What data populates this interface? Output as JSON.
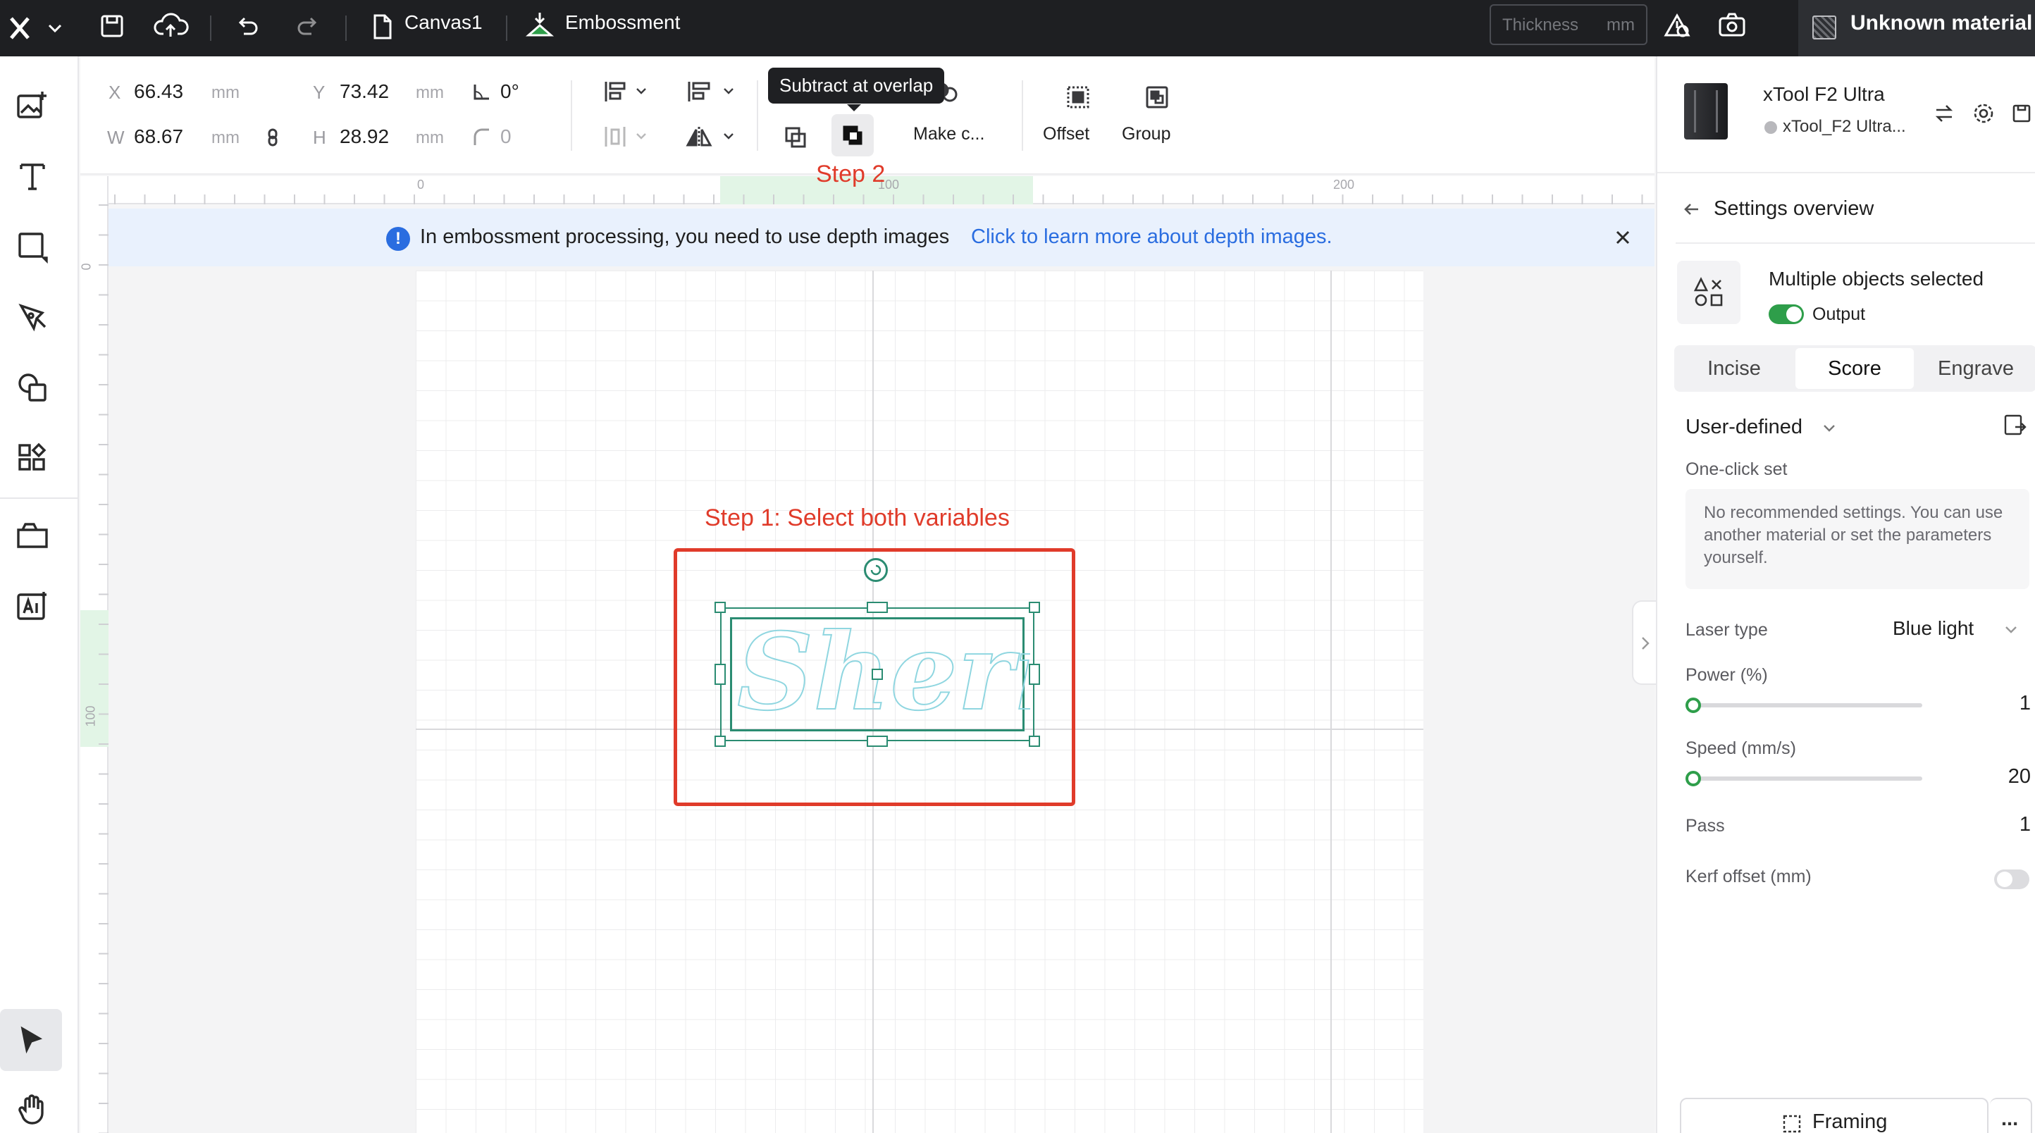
{
  "topbar": {
    "file_name": "Canvas1",
    "mode_name": "Embossment",
    "thickness_placeholder": "Thickness",
    "thickness_unit": "mm",
    "material_label": "Unknown material"
  },
  "props": {
    "x_label": "X",
    "x_value": "66.43",
    "x_unit": "mm",
    "y_label": "Y",
    "y_value": "73.42",
    "y_unit": "mm",
    "rotation_value": "0°",
    "w_label": "W",
    "w_value": "68.67",
    "w_unit": "mm",
    "h_label": "H",
    "h_value": "28.92",
    "h_unit": "mm",
    "corner_value": "0",
    "make_label": "Make c...",
    "offset_label": "Offset",
    "group_label": "Group",
    "tooltip": "Subtract at overlap"
  },
  "ruler": {
    "h_ticks": [
      "0",
      "100",
      "200"
    ],
    "v_ticks": [
      "0",
      "100"
    ]
  },
  "banner": {
    "text": "In embossment processing, you need to use depth images",
    "link": "Click to learn more about depth images."
  },
  "annotations": {
    "step1": "Step 1: Select both variables",
    "step2": "Step 2"
  },
  "canvas": {
    "design_text": "Sherry"
  },
  "device": {
    "name": "xTool F2 Ultra",
    "profile": "xTool_F2 Ultra..."
  },
  "settings": {
    "back_title": "Settings overview",
    "selection_title": "Multiple objects selected",
    "output_label": "Output",
    "output_on": true,
    "tabs": [
      "Incise",
      "Score",
      "Engrave"
    ],
    "active_tab": "Score",
    "preset": "User-defined",
    "one_click_label": "One-click set",
    "one_click_info": "No recommended settings. You can use another material or set the parameters yourself.",
    "laser_type_label": "Laser type",
    "laser_type_value": "Blue light",
    "power_label": "Power (%)",
    "power_value": "1",
    "speed_label": "Speed (mm/s)",
    "speed_value": "20",
    "pass_label": "Pass",
    "pass_value": "1",
    "kerf_label": "Kerf offset (mm)",
    "kerf_on": false,
    "framing_label": "Framing",
    "more_label": "..."
  },
  "colors": {
    "accent_green": "#2e9e4a",
    "annotation_red": "#e03b2a",
    "link_blue": "#2a6de0",
    "selection_teal": "#2b8c72"
  }
}
